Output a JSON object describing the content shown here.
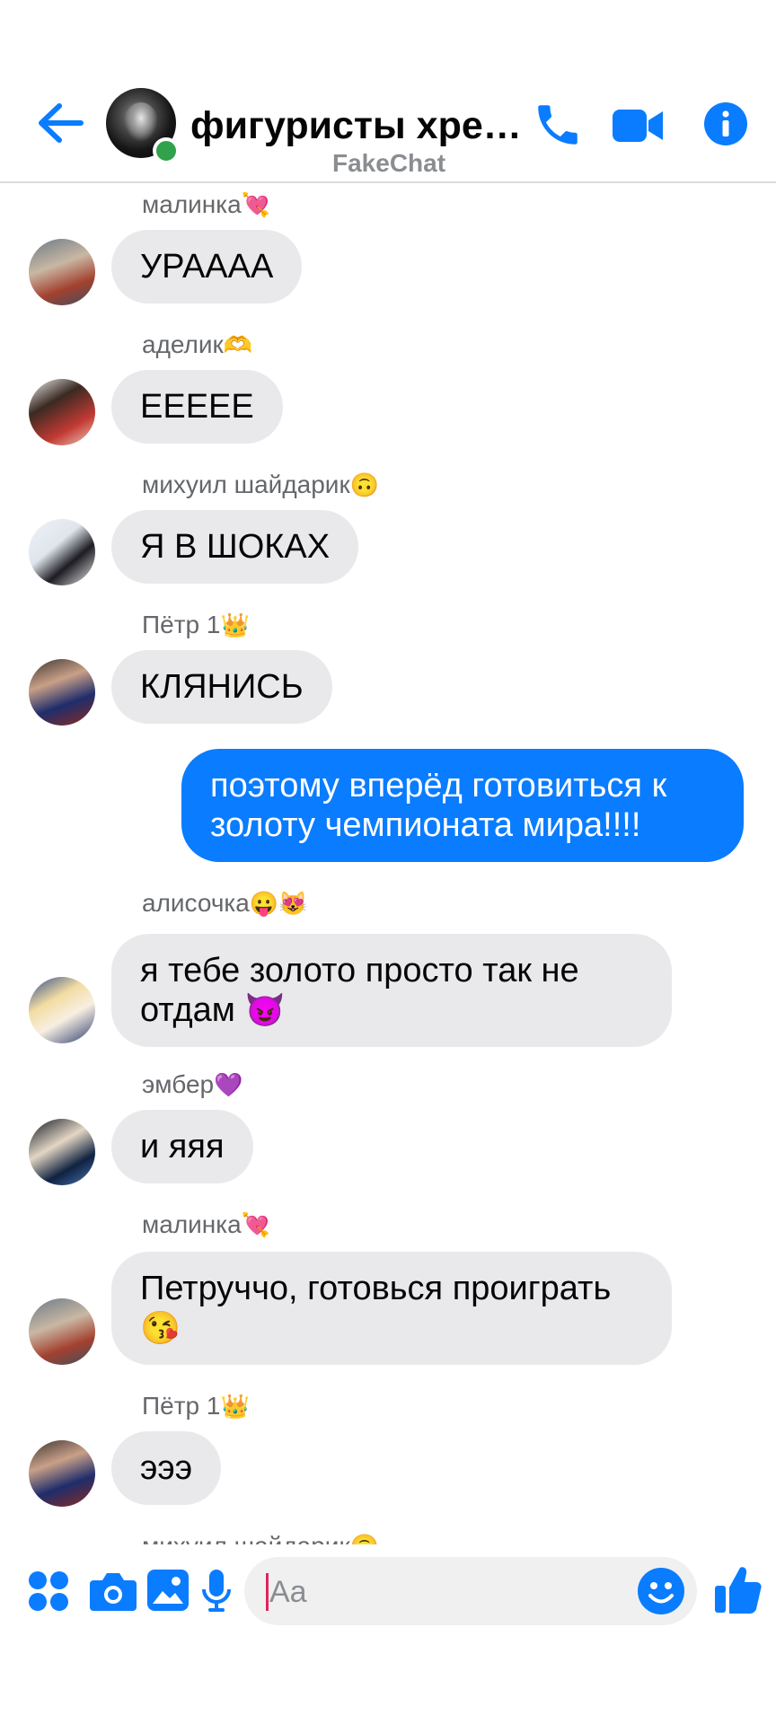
{
  "header": {
    "title": "фигуристы хрено…",
    "subtitle": "FakeChat"
  },
  "messages": [
    {
      "sender": "малинка",
      "sender_emoji": "💘",
      "text": "УРААAA",
      "from_me": false
    },
    {
      "sender": "аделик",
      "sender_emoji": "🫶",
      "text": "ЕЕЕЕЕ",
      "from_me": false
    },
    {
      "sender": "михуил шайдарик",
      "sender_emoji": "🙃",
      "text": "Я В ШОКАХ",
      "from_me": false
    },
    {
      "sender": "Пётр 1",
      "sender_emoji": "👑",
      "text": "КЛЯНИСЬ",
      "from_me": false
    },
    {
      "sender": "",
      "sender_emoji": "",
      "text": "поэтому вперёд готовиться к золоту чемпионата мира!!!!",
      "from_me": true
    },
    {
      "sender": "алисочка",
      "sender_emoji": "😛😻",
      "text": "я тебе золото просто так не отдам",
      "text_emoji": "😈",
      "from_me": false
    },
    {
      "sender": "эмбер",
      "sender_emoji": "💜",
      "text": "и яяя",
      "from_me": false
    },
    {
      "sender": "малинка",
      "sender_emoji": "💘",
      "text": "Петруччо, готовься проиграть",
      "text_emoji": "😘",
      "from_me": false
    },
    {
      "sender": "Пётр 1",
      "sender_emoji": "👑",
      "text": "эээ",
      "from_me": false
    },
    {
      "sender": "михуил шайдарик",
      "sender_emoji": "🙃",
      "text": "",
      "from_me": false
    }
  ],
  "composer": {
    "placeholder": "Aa"
  },
  "colors": {
    "accent": "#0a7cff",
    "incoming_bubble": "#e9e9eb",
    "online": "#31a24c",
    "secondary_text": "#65676b"
  },
  "icons": {
    "back": "arrow-left-icon",
    "call": "phone-icon",
    "video": "video-camera-icon",
    "info": "info-icon",
    "apps": "four-dots-icon",
    "camera": "camera-icon",
    "gallery": "image-icon",
    "mic": "microphone-icon",
    "emoji": "smiley-icon",
    "like": "thumbs-up-icon"
  }
}
